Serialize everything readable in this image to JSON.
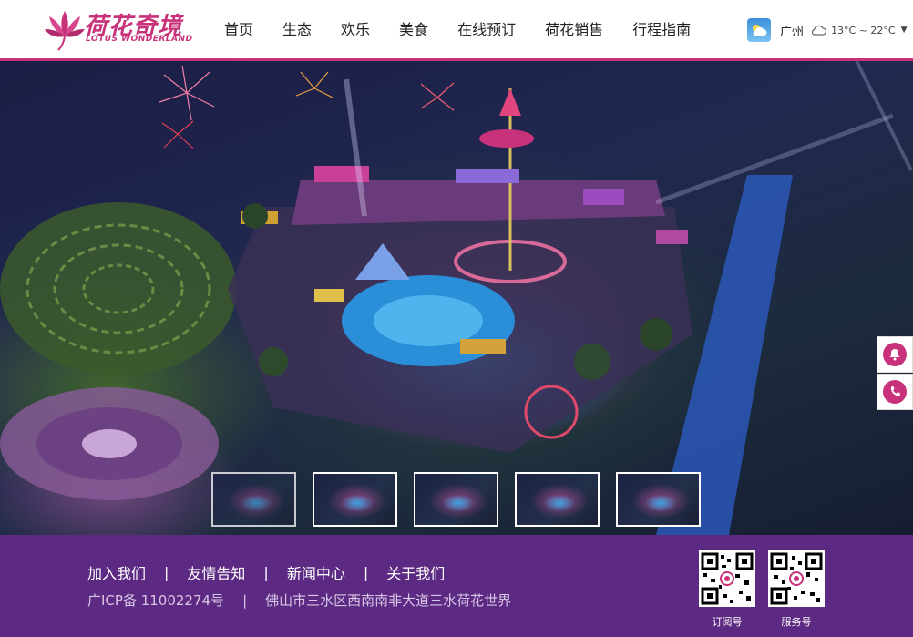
{
  "header": {
    "logo_cn": "荷花奇境",
    "logo_en": "LOTUS WONDERLAND",
    "nav": [
      {
        "label": "首页",
        "name": "nav-home"
      },
      {
        "label": "生态",
        "name": "nav-ecology"
      },
      {
        "label": "欢乐",
        "name": "nav-fun"
      },
      {
        "label": "美食",
        "name": "nav-food"
      },
      {
        "label": "在线预订",
        "name": "nav-booking"
      },
      {
        "label": "荷花销售",
        "name": "nav-lotus-sales"
      },
      {
        "label": "行程指南",
        "name": "nav-guide"
      }
    ],
    "weather": {
      "city": "广州",
      "temp": "13°C ~ 22°C",
      "icon": "cloudy-icon"
    }
  },
  "banner": {
    "thumbnails": [
      {
        "active": true
      },
      {
        "active": false
      },
      {
        "active": false
      },
      {
        "active": false
      },
      {
        "active": false
      }
    ]
  },
  "side": {
    "buttons": [
      {
        "name": "customer-service-button",
        "icon": "bell-icon"
      },
      {
        "name": "phone-button",
        "icon": "phone-icon"
      }
    ]
  },
  "footer": {
    "links": [
      "加入我们",
      "友情告知",
      "新闻中心",
      "关于我们"
    ],
    "separator": "|",
    "icp": "广ICP备 11002274号",
    "address": "佛山市三水区西南南非大道三水荷花世界",
    "qr": [
      {
        "label": "订阅号"
      },
      {
        "label": "服务号"
      }
    ]
  },
  "colors": {
    "brand": "#c8327a",
    "footer_bg": "#5c2a82"
  }
}
